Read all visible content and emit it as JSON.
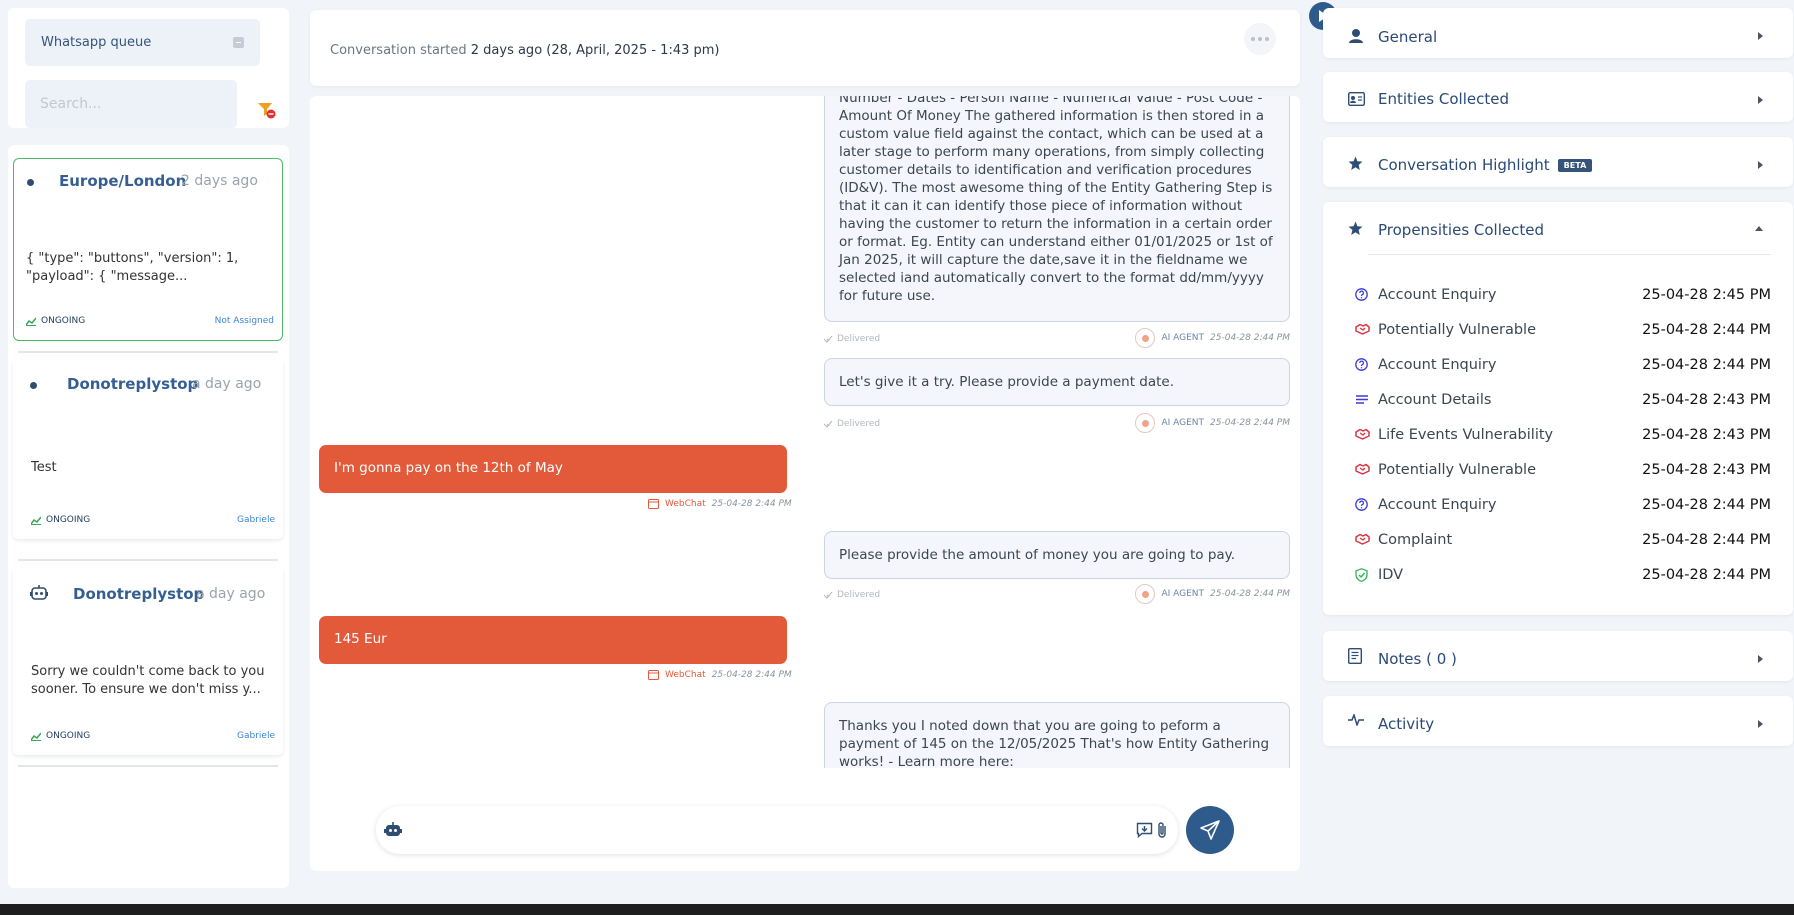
{
  "sidebar": {
    "queue_label": "Whatsapp queue",
    "search_placeholder": "Search...",
    "conversations": [
      {
        "name": "Europe/London",
        "time": "2 days ago",
        "preview": "{ \"type\": \"buttons\", \"version\": 1, \"payload\": { \"message...",
        "status": "ONGOING",
        "assignee": "Not Assigned",
        "avatar": "dot"
      },
      {
        "name": "Donotreplystop",
        "time": "a day ago",
        "preview": "Test",
        "status": "ONGOING",
        "assignee": "Gabriele",
        "avatar": "dot"
      },
      {
        "name": "Donotreplystop",
        "time": "a day ago",
        "preview": "Sorry we couldn't come back to you sooner. To ensure we don't miss y...",
        "status": "ONGOING",
        "assignee": "Gabriele",
        "avatar": "robot-icon"
      }
    ]
  },
  "chat": {
    "started_prefix": "Conversation started ",
    "started_value": "2 days ago (28, April, 2025 - 1:43 pm)",
    "messages": [
      {
        "from": "bot",
        "text": "Number - Dates - Person Name - Numerical Value - Post Code - Amount Of Money The gathered information is then stored in a custom value field against the contact, which can be used at a later stage to perform many operations, from simply collecting customer details to identification and verification procedures (ID&V). The most awesome thing of the Entity Gathering Step is that it can it can identify those piece of information without having the customer to return the information in a certain order or format. Eg. Entity can understand either 01/01/2025 or 1st of Jan 2025, it will capture the date,save it in the fieldname we selected iand automatically convert to the format dd/mm/yyyy for future use.",
        "delivered": "Delivered",
        "sender": "AI AGENT",
        "time": "25-04-28 2:44 PM"
      },
      {
        "from": "bot",
        "text": "Let's give it a try. Please provide a payment date.",
        "delivered": "Delivered",
        "sender": "AI AGENT",
        "time": "25-04-28 2:44 PM"
      },
      {
        "from": "user",
        "text": "I'm gonna pay on the 12th of May",
        "channel": "WebChat",
        "time": "25-04-28 2:44 PM"
      },
      {
        "from": "bot",
        "text": "Please provide the amount of money you are going to pay.",
        "delivered": "Delivered",
        "sender": "AI AGENT",
        "time": "25-04-28 2:44 PM"
      },
      {
        "from": "user",
        "text": "145 Eur",
        "channel": "WebChat",
        "time": "25-04-28 2:44 PM"
      },
      {
        "from": "bot",
        "text": "Thanks you I noted down that you are going to peform a payment of 145 on the 12/05/2025 That's how Entity Gathering works! - Learn more here:"
      }
    ],
    "composer_value": ""
  },
  "right_panel": {
    "general": "General",
    "entities": "Entities Collected",
    "highlight": "Conversation Highlight",
    "highlight_badge": "BETA",
    "propensities": "Propensities Collected",
    "propensity_items": [
      {
        "name": "Account Enquiry",
        "time": "25-04-28 2:45 PM",
        "icon": "question-circle-icon",
        "color": "#3b3bd6"
      },
      {
        "name": "Potentially Vulnerable",
        "time": "25-04-28 2:44 PM",
        "icon": "handshake-icon",
        "color": "#d9343f"
      },
      {
        "name": "Account Enquiry",
        "time": "25-04-28 2:44 PM",
        "icon": "question-circle-icon",
        "color": "#3b3bd6"
      },
      {
        "name": "Account Details",
        "time": "25-04-28 2:43 PM",
        "icon": "lines-icon",
        "color": "#3b3bd6"
      },
      {
        "name": "Life Events Vulnerability",
        "time": "25-04-28 2:43 PM",
        "icon": "handshake-icon",
        "color": "#d9343f"
      },
      {
        "name": "Potentially Vulnerable",
        "time": "25-04-28 2:43 PM",
        "icon": "handshake-icon",
        "color": "#d9343f"
      },
      {
        "name": "Account Enquiry",
        "time": "25-04-28 2:44 PM",
        "icon": "question-circle-icon",
        "color": "#3b3bd6"
      },
      {
        "name": "Complaint",
        "time": "25-04-28 2:44 PM",
        "icon": "handshake-icon",
        "color": "#d9343f"
      },
      {
        "name": "IDV",
        "time": "25-04-28 2:44 PM",
        "icon": "shield-check-icon",
        "color": "#2fb457"
      }
    ],
    "notes": "Notes ( 0 )",
    "activity": "Activity"
  },
  "colors": {
    "accent": "#2e5b8c",
    "user_bubble": "#e35a3a",
    "ongoing_border": "#4dbb6a",
    "link_blue": "#3a86d8"
  }
}
